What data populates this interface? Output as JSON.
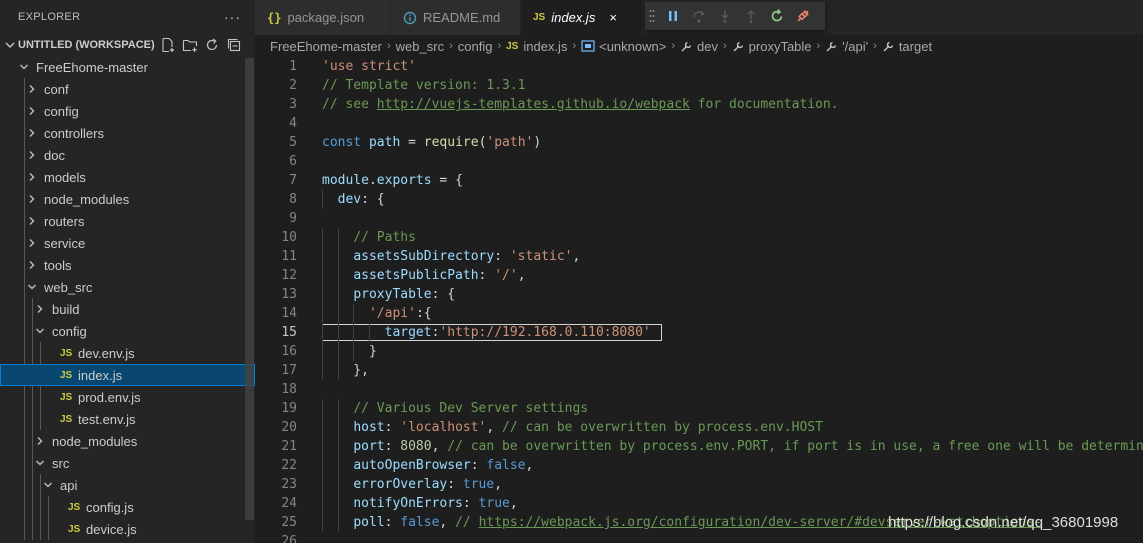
{
  "sidebar": {
    "title": "EXPLORER",
    "more": "···",
    "workspace": "UNTITLED (WORKSPACE)",
    "tree": [
      {
        "label": "FreeEhome-master",
        "kind": "folder-open",
        "depth": 0
      },
      {
        "label": "conf",
        "kind": "folder",
        "depth": 1
      },
      {
        "label": "config",
        "kind": "folder",
        "depth": 1
      },
      {
        "label": "controllers",
        "kind": "folder",
        "depth": 1
      },
      {
        "label": "doc",
        "kind": "folder",
        "depth": 1
      },
      {
        "label": "models",
        "kind": "folder",
        "depth": 1
      },
      {
        "label": "node_modules",
        "kind": "folder",
        "depth": 1
      },
      {
        "label": "routers",
        "kind": "folder",
        "depth": 1
      },
      {
        "label": "service",
        "kind": "folder",
        "depth": 1
      },
      {
        "label": "tools",
        "kind": "folder",
        "depth": 1
      },
      {
        "label": "web_src",
        "kind": "folder-open",
        "depth": 1
      },
      {
        "label": "build",
        "kind": "folder",
        "depth": 2
      },
      {
        "label": "config",
        "kind": "folder-open",
        "depth": 2
      },
      {
        "label": "dev.env.js",
        "kind": "js",
        "depth": 3
      },
      {
        "label": "index.js",
        "kind": "js",
        "depth": 3,
        "selected": true
      },
      {
        "label": "prod.env.js",
        "kind": "js",
        "depth": 3
      },
      {
        "label": "test.env.js",
        "kind": "js",
        "depth": 3
      },
      {
        "label": "node_modules",
        "kind": "folder",
        "depth": 2
      },
      {
        "label": "src",
        "kind": "folder-open",
        "depth": 2
      },
      {
        "label": "api",
        "kind": "folder-open",
        "depth": 3
      },
      {
        "label": "config.js",
        "kind": "js",
        "depth": 4
      },
      {
        "label": "device.js",
        "kind": "js",
        "depth": 4
      }
    ]
  },
  "tabs": [
    {
      "label": "package.json",
      "icon": "braces-icon",
      "active": false
    },
    {
      "label": "README.md",
      "icon": "info-icon",
      "active": false
    },
    {
      "label": "index.js",
      "icon": "js-icon",
      "active": true,
      "close": "×"
    }
  ],
  "breadcrumb": [
    "FreeEhome-master",
    "web_src",
    "config",
    "index.js",
    "<unknown>",
    "dev",
    "proxyTable",
    "'/api'",
    "target"
  ],
  "editor": {
    "active_line": 15,
    "lines": [
      [
        [
          "s",
          "'use strict'"
        ]
      ],
      [
        [
          "c",
          "// Template version: 1.3.1"
        ]
      ],
      [
        [
          "c",
          "// see "
        ],
        [
          "cu",
          "http://vuejs-templates.github.io/webpack"
        ],
        [
          "c",
          " for documentation."
        ]
      ],
      [],
      [
        [
          "k",
          "const "
        ],
        [
          "v",
          "path"
        ],
        [
          "p",
          " = "
        ],
        [
          "f",
          "require"
        ],
        [
          "p",
          "("
        ],
        [
          "s",
          "'path'"
        ],
        [
          "p",
          ")"
        ]
      ],
      [],
      [
        [
          "v",
          "module"
        ],
        [
          "p",
          "."
        ],
        [
          "v",
          "exports"
        ],
        [
          "p",
          " = {"
        ]
      ],
      [
        [
          "p",
          "  "
        ],
        [
          "v",
          "dev"
        ],
        [
          "p",
          ": {"
        ]
      ],
      [],
      [
        [
          "p",
          "    "
        ],
        [
          "c",
          "// Paths"
        ]
      ],
      [
        [
          "p",
          "    "
        ],
        [
          "v",
          "assetsSubDirectory"
        ],
        [
          "p",
          ": "
        ],
        [
          "s",
          "'static'"
        ],
        [
          "p",
          ","
        ]
      ],
      [
        [
          "p",
          "    "
        ],
        [
          "v",
          "assetsPublicPath"
        ],
        [
          "p",
          ": "
        ],
        [
          "s",
          "'/'"
        ],
        [
          "p",
          ","
        ]
      ],
      [
        [
          "p",
          "    "
        ],
        [
          "v",
          "proxyTable"
        ],
        [
          "p",
          ": {"
        ]
      ],
      [
        [
          "p",
          "      "
        ],
        [
          "s",
          "'/api'"
        ],
        [
          "p",
          ":{"
        ]
      ],
      [
        [
          "p",
          "        "
        ],
        [
          "v",
          "target"
        ],
        [
          "p",
          ":"
        ],
        [
          "s",
          "'http://192.168.0.110:8080'"
        ]
      ],
      [
        [
          "p",
          "      }"
        ]
      ],
      [
        [
          "p",
          "    },"
        ]
      ],
      [],
      [
        [
          "p",
          "    "
        ],
        [
          "c",
          "// Various Dev Server settings"
        ]
      ],
      [
        [
          "p",
          "    "
        ],
        [
          "v",
          "host"
        ],
        [
          "p",
          ": "
        ],
        [
          "s",
          "'localhost'"
        ],
        [
          "p",
          ", "
        ],
        [
          "c",
          "// can be overwritten by process.env.HOST"
        ]
      ],
      [
        [
          "p",
          "    "
        ],
        [
          "v",
          "port"
        ],
        [
          "p",
          ": "
        ],
        [
          "n",
          "8080"
        ],
        [
          "p",
          ", "
        ],
        [
          "c",
          "// can be overwritten by process.env.PORT, if port is in use, a free one will be determined"
        ]
      ],
      [
        [
          "p",
          "    "
        ],
        [
          "v",
          "autoOpenBrowser"
        ],
        [
          "p",
          ": "
        ],
        [
          "k",
          "false"
        ],
        [
          "p",
          ","
        ]
      ],
      [
        [
          "p",
          "    "
        ],
        [
          "v",
          "errorOverlay"
        ],
        [
          "p",
          ": "
        ],
        [
          "k",
          "true"
        ],
        [
          "p",
          ","
        ]
      ],
      [
        [
          "p",
          "    "
        ],
        [
          "v",
          "notifyOnErrors"
        ],
        [
          "p",
          ": "
        ],
        [
          "k",
          "true"
        ],
        [
          "p",
          ","
        ]
      ],
      [
        [
          "p",
          "    "
        ],
        [
          "v",
          "poll"
        ],
        [
          "p",
          ": "
        ],
        [
          "k",
          "false"
        ],
        [
          "p",
          ", "
        ],
        [
          "c",
          "// "
        ],
        [
          "cu",
          "https://webpack.js.org/configuration/dev-server/#devserver-watchoptions-"
        ]
      ],
      []
    ]
  },
  "watermark": "https://blog.csdn.net/qq_36801998",
  "colors": {
    "accent": "#007fd4",
    "selection": "#094771",
    "js": "#cbcb41"
  }
}
